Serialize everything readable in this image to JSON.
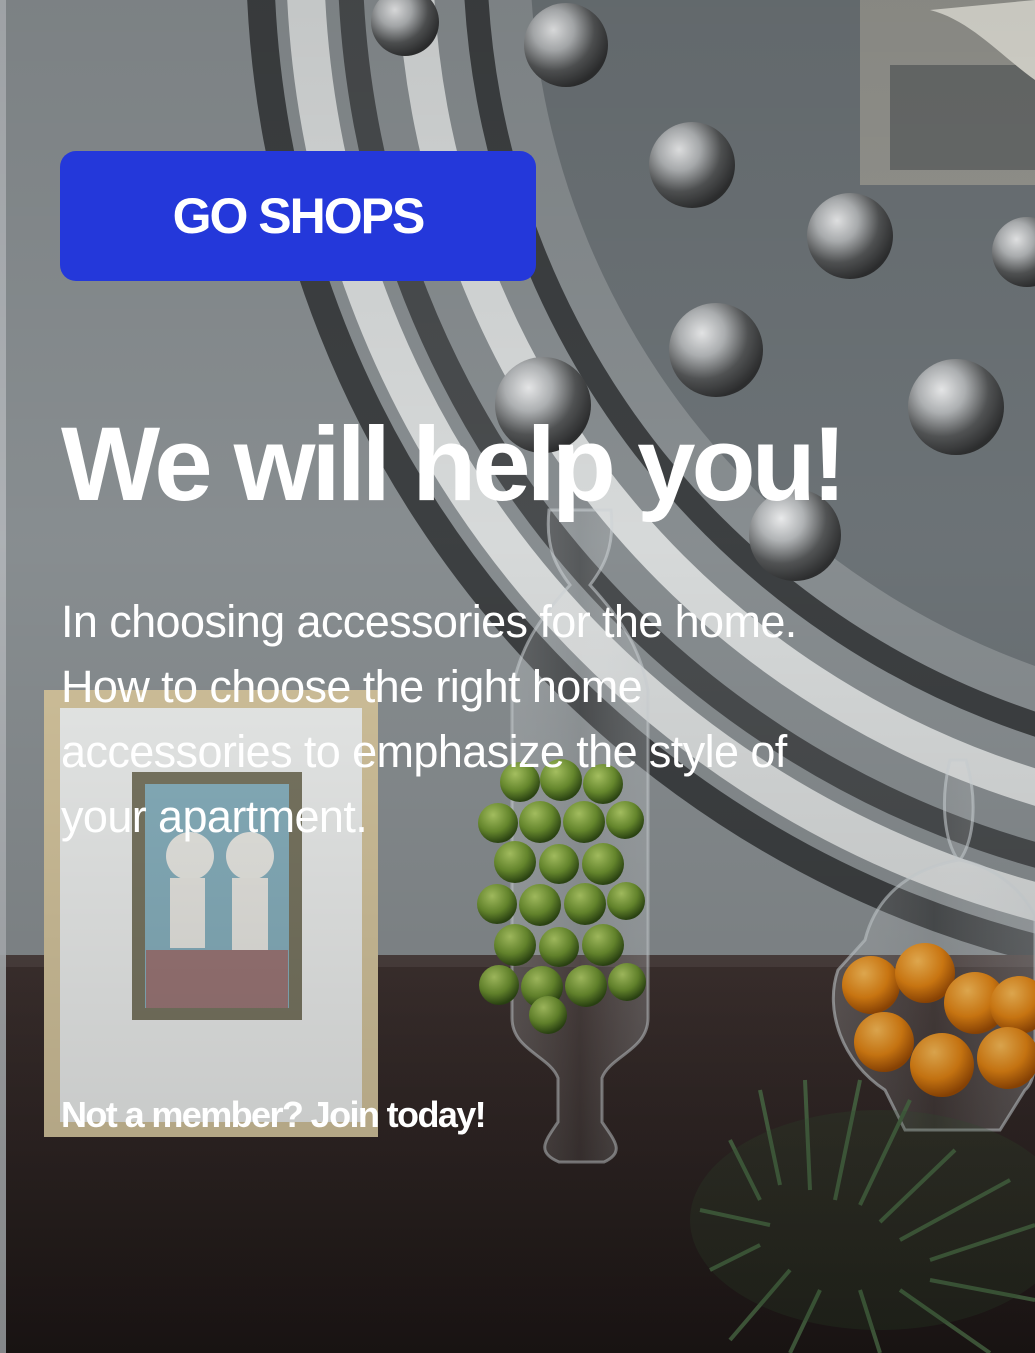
{
  "hero": {
    "button_label": "GO SHOPS",
    "title": "We will help you!",
    "description": "In choosing accessories for the home. How to choose the right home accessories to emphasize the style of your apartment.",
    "join_link": "Not a member? Join today!"
  },
  "colors": {
    "primary_button": "#2438DA",
    "text": "#FFFFFF"
  }
}
